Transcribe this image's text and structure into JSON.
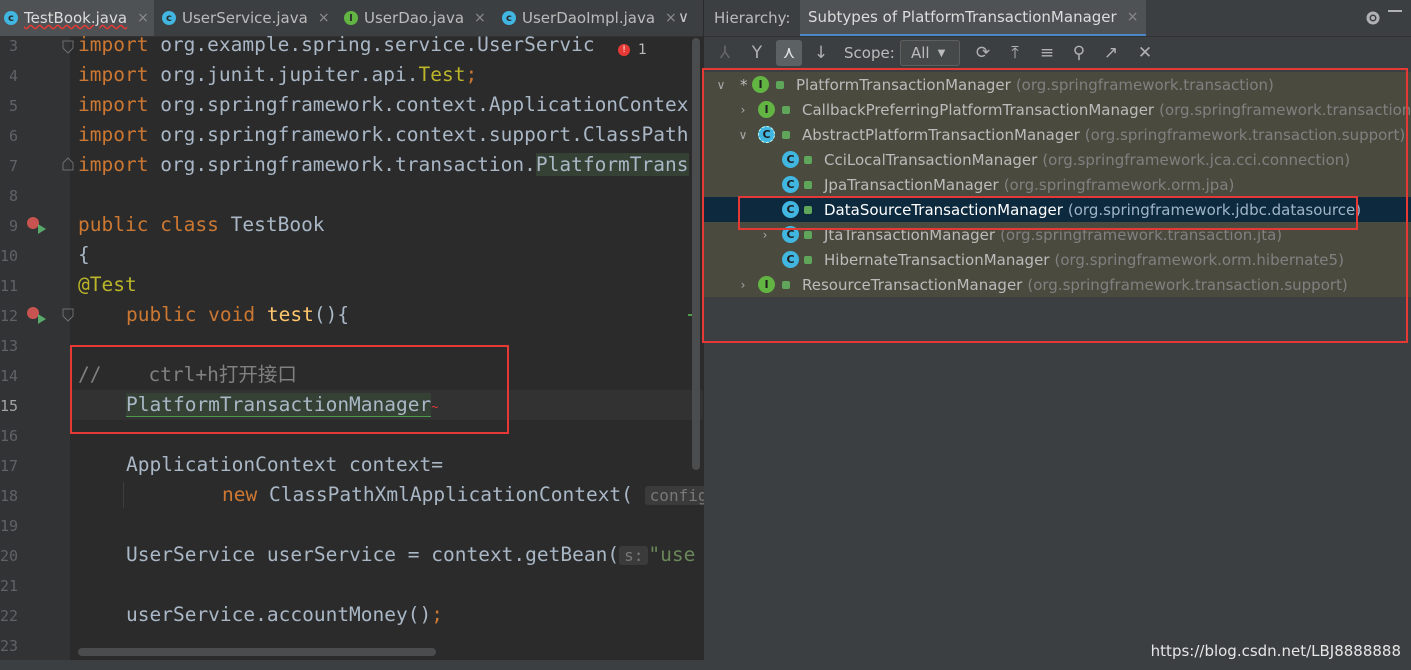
{
  "editor": {
    "tabs": [
      {
        "label": "TestBook.java",
        "icon": "class-icon"
      },
      {
        "label": "UserService.java",
        "icon": "class-icon"
      },
      {
        "label": "UserDao.java",
        "icon": "interface-icon"
      },
      {
        "label": "UserDaoImpl.java",
        "icon": "class-icon"
      }
    ],
    "close_glyph": "×",
    "more_glyph": "∨",
    "error_count": "1",
    "line_numbers": [
      "3",
      "4",
      "5",
      "6",
      "7",
      "8",
      "9",
      "10",
      "11",
      "12",
      "13",
      "14",
      "15",
      "16",
      "17",
      "18",
      "19",
      "20",
      "21",
      "22",
      "23"
    ],
    "code": {
      "l3a": "import ",
      "l3b": "org.example.spring.service.UserServic",
      "l4a": "import ",
      "l4b": "org.junit.jupiter.api.",
      "l4c": "Test",
      "l4d": ";",
      "l5a": "import ",
      "l5b": "org.springframework.context.ApplicationContex",
      "l6a": "import ",
      "l6b": "org.springframework.context.support.ClassPath",
      "l7a": "import ",
      "l7b": "org.springframework.transaction.",
      "l7c": "PlatformTrans",
      "l9a": "public class ",
      "l9b": "TestBook",
      "l10": "{",
      "l11": "@Test",
      "l12a": "public void ",
      "l12b": "test",
      "l12c": "(){",
      "l14": "//    ctrl+h打开接口",
      "l15": "PlatformTransactionManager",
      "l17": "ApplicationContext context=",
      "l18a": "new ",
      "l18b": "ClassPathXmlApplicationContext(",
      "l18c": "config",
      "l20a": "UserService userService = context.getBean(",
      "l20b": "s:",
      "l20c": "\"use",
      "l22a": "userService.accountMoney()",
      "l22b": ";"
    }
  },
  "hierarchy": {
    "label": "Hierarchy:",
    "tab": "Subtypes of PlatformTransactionManager",
    "tab_close": "×",
    "scope_label": "Scope:",
    "scope_value": "All",
    "tree": [
      {
        "name": "PlatformTransactionManager",
        "pkg": "(org.springframework.transaction)",
        "kind": "interface",
        "arrow": "∨",
        "star": "*"
      },
      {
        "name": "CallbackPreferringPlatformTransactionManager",
        "pkg": "(org.springframework.transaction.s",
        "kind": "interface",
        "arrow": "›"
      },
      {
        "name": "AbstractPlatformTransactionManager",
        "pkg": "(org.springframework.transaction.support)",
        "kind": "abstract",
        "arrow": "∨"
      },
      {
        "name": "CciLocalTransactionManager",
        "pkg": "(org.springframework.jca.cci.connection)",
        "kind": "class"
      },
      {
        "name": "JpaTransactionManager",
        "pkg": "(org.springframework.orm.jpa)",
        "kind": "class"
      },
      {
        "name": "DataSourceTransactionManager",
        "pkg": "(org.springframework.jdbc.datasource)",
        "kind": "class"
      },
      {
        "name": "JtaTransactionManager",
        "pkg": "(org.springframework.transaction.jta)",
        "kind": "class",
        "arrow": "›"
      },
      {
        "name": "HibernateTransactionManager",
        "pkg": "(org.springframework.orm.hibernate5)",
        "kind": "class"
      },
      {
        "name": "ResourceTransactionManager",
        "pkg": "(org.springframework.transaction.support)",
        "kind": "interface",
        "arrow": "›"
      }
    ]
  },
  "watermark": "https://blog.csdn.net/LBJ8888888",
  "colors": {
    "accent_red": "#e53935",
    "selection": "#0d293e",
    "interface": "#62b543",
    "class": "#40b6e0"
  }
}
